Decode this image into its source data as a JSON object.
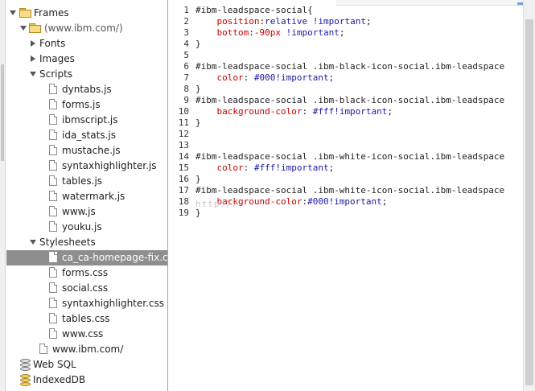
{
  "tree": {
    "frames_label": "Frames",
    "frame_label": "(www.ibm.com/)",
    "fonts_label": "Fonts",
    "images_label": "Images",
    "scripts_label": "Scripts",
    "scripts": [
      "dyntabs.js",
      "forms.js",
      "ibmscript.js",
      "ida_stats.js",
      "mustache.js",
      "syntaxhighlighter.js",
      "tables.js",
      "watermark.js",
      "www.js",
      "youku.js"
    ],
    "stylesheets_label": "Stylesheets",
    "stylesheets": [
      "ca_ca-homepage-fix.css",
      "forms.css",
      "social.css",
      "syntaxhighlighter.css",
      "tables.css",
      "www.css"
    ],
    "document_label": "www.ibm.com/",
    "websql_label": "Web SQL",
    "indexeddb_label": "IndexedDB"
  },
  "editor": {
    "line_numbers": [
      "1",
      "2",
      "3",
      "4",
      "5",
      "6",
      "7",
      "8",
      "9",
      "10",
      "11",
      "12",
      "13",
      "14",
      "15",
      "16",
      "17",
      "18",
      "19"
    ],
    "lines": [
      [
        {
          "t": "#ibm-leadspace-social{",
          "c": "sel"
        }
      ],
      [
        {
          "t": "    position",
          "c": "prop"
        },
        {
          "t": ":",
          "c": "sel"
        },
        {
          "t": "relative !important",
          "c": "val"
        },
        {
          "t": ";",
          "c": "sel"
        }
      ],
      [
        {
          "t": "    bottom",
          "c": "prop"
        },
        {
          "t": ":",
          "c": "sel"
        },
        {
          "t": "-90px",
          "c": "prop"
        },
        {
          "t": " !important",
          "c": "val"
        },
        {
          "t": ";",
          "c": "sel"
        }
      ],
      [
        {
          "t": "}",
          "c": "sel"
        }
      ],
      [],
      [
        {
          "t": "#ibm-leadspace-social .ibm-black-icon-social.ibm-leadspace",
          "c": "sel"
        }
      ],
      [
        {
          "t": "    color",
          "c": "prop"
        },
        {
          "t": ": ",
          "c": "sel"
        },
        {
          "t": "#000!important",
          "c": "hex"
        },
        {
          "t": ";",
          "c": "sel"
        }
      ],
      [
        {
          "t": "}",
          "c": "sel"
        }
      ],
      [
        {
          "t": "#ibm-leadspace-social .ibm-black-icon-social.ibm-leadspace",
          "c": "sel"
        }
      ],
      [
        {
          "t": "    background-color",
          "c": "prop"
        },
        {
          "t": ": ",
          "c": "sel"
        },
        {
          "t": "#fff!important",
          "c": "hex"
        },
        {
          "t": ";",
          "c": "sel"
        }
      ],
      [
        {
          "t": "}",
          "c": "sel"
        }
      ],
      [],
      [],
      [
        {
          "t": "#ibm-leadspace-social .ibm-white-icon-social.ibm-leadspace",
          "c": "sel"
        }
      ],
      [
        {
          "t": "    color",
          "c": "prop"
        },
        {
          "t": ": ",
          "c": "sel"
        },
        {
          "t": "#fff!important",
          "c": "hex"
        },
        {
          "t": ";",
          "c": "sel"
        }
      ],
      [
        {
          "t": "}",
          "c": "sel"
        }
      ],
      [
        {
          "t": "#ibm-leadspace-social .ibm-white-icon-social.ibm-leadspace",
          "c": "sel"
        }
      ],
      [
        {
          "t": "    background-color",
          "c": "prop"
        },
        {
          "t": ":",
          "c": "sel"
        },
        {
          "t": "#000!important",
          "c": "hex"
        },
        {
          "t": ";",
          "c": "sel"
        }
      ],
      [
        {
          "t": "}",
          "c": "sel"
        }
      ]
    ],
    "watermark": "http://"
  }
}
